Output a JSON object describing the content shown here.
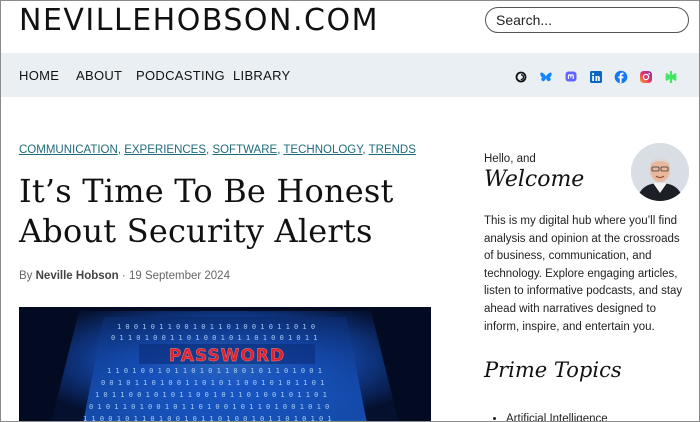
{
  "header": {
    "logo_text": "NEVILLEHOBSON.COM",
    "search_placeholder": "Search..."
  },
  "nav": {
    "items": [
      "HOME",
      "ABOUT",
      "PODCASTING",
      "LIBRARY"
    ],
    "social_icons": [
      "threads-icon",
      "bluesky-icon",
      "mastodon-icon",
      "linkedin-icon",
      "facebook-icon",
      "instagram-icon",
      "linktree-icon"
    ]
  },
  "article": {
    "categories": [
      "COMMUNICATION",
      "EXPERIENCES",
      "SOFTWARE",
      "TECHNOLOGY",
      "TRENDS"
    ],
    "category_separator": ",",
    "title": "It’s Time To Be Honest About Security Alerts",
    "by_label": "By",
    "author": "Neville Hobson",
    "dot": "·",
    "date": "19 September 2024",
    "hero_word": "PASSWORD"
  },
  "sidebar": {
    "hello": "Hello, and",
    "welcome": "Welcome",
    "intro": "This is my digital hub where you’ll find analysis and opinion at the crossroads of business, communication, and technology. Explore engaging articles, listen to informative podcasts, and stay ahead with narratives designed to inform, inspire, and entertain you.",
    "prime_heading": "Prime Topics",
    "topics": [
      "Artificial Intelligence"
    ]
  },
  "colors": {
    "nav_bg": "#eaeff3",
    "category_link": "#1f6b7a",
    "hero_blue": "#1a5bd6",
    "password_red": "#e0202a"
  }
}
